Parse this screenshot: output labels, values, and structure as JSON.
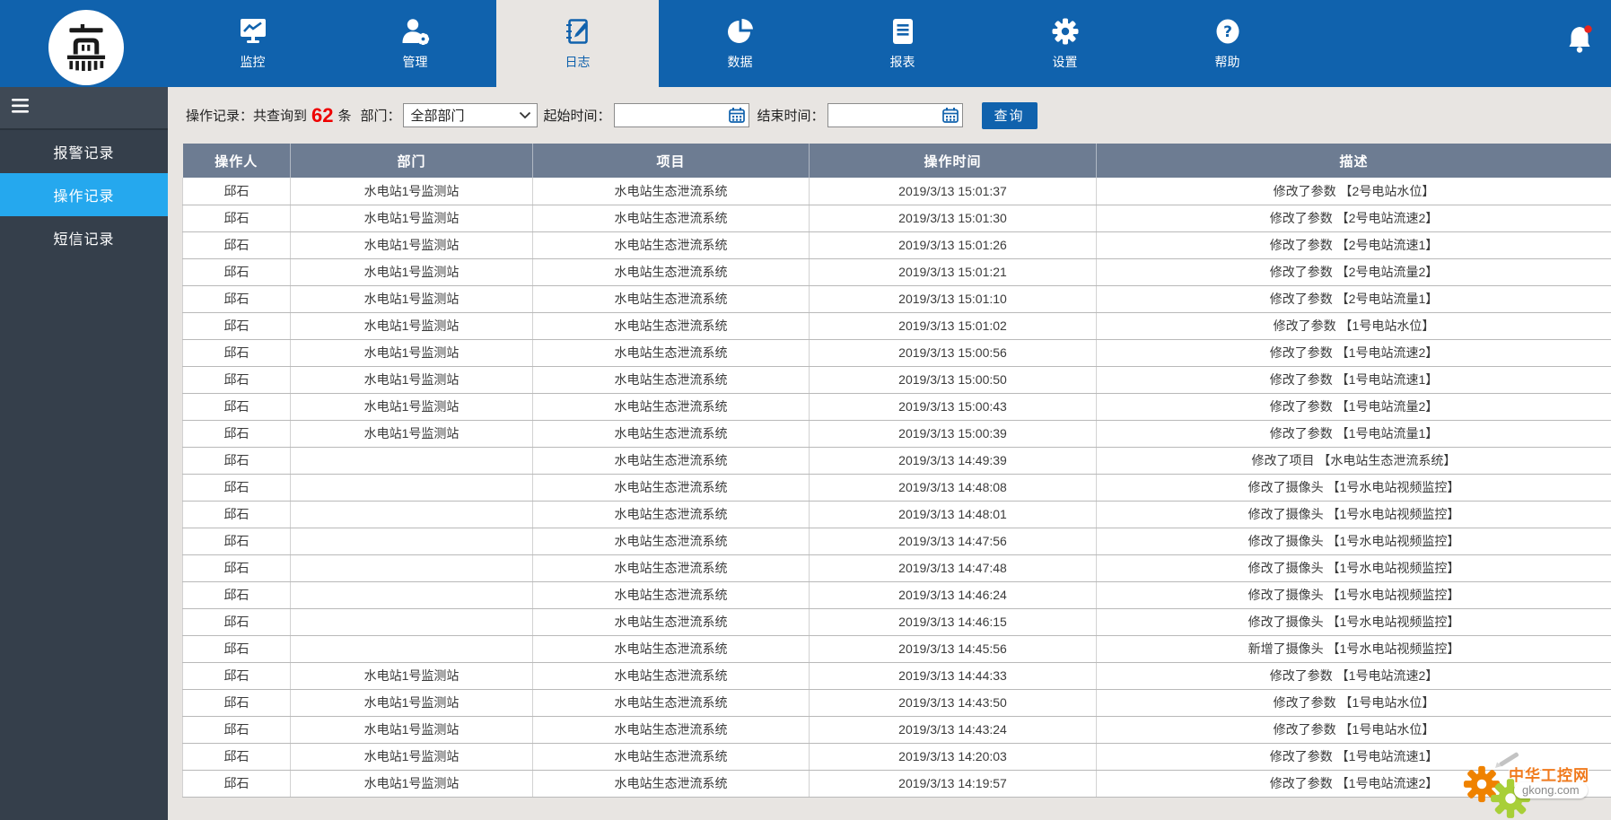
{
  "nav": {
    "items": [
      {
        "label": "监控",
        "icon": "monitor-chart-icon",
        "active": false
      },
      {
        "label": "管理",
        "icon": "user-gear-icon",
        "active": false
      },
      {
        "label": "日志",
        "icon": "log-notebook-icon",
        "active": true
      },
      {
        "label": "数据",
        "icon": "pie-chart-icon",
        "active": false
      },
      {
        "label": "报表",
        "icon": "report-document-icon",
        "active": false
      },
      {
        "label": "设置",
        "icon": "gear-icon",
        "active": false
      },
      {
        "label": "帮助",
        "icon": "help-icon",
        "active": false
      }
    ],
    "notification_icon": "bell-icon",
    "has_notification_dot": true
  },
  "sidebar": {
    "menu_icon": "hamburger-menu-icon",
    "items": [
      {
        "label": "报警记录",
        "active": false
      },
      {
        "label": "操作记录",
        "active": true
      },
      {
        "label": "短信记录",
        "active": false
      }
    ]
  },
  "filter": {
    "summary_prefix": "操作记录：共查询到",
    "summary_count": "62",
    "summary_suffix": "条",
    "department_label": "部门：",
    "department_value": "全部部门",
    "start_time_label": "起始时间：",
    "start_time_value": "",
    "end_time_label": "结束时间：",
    "end_time_value": "",
    "search_button": "查询"
  },
  "table": {
    "columns": [
      "操作人",
      "部门",
      "项目",
      "操作时间",
      "描述"
    ],
    "rows": [
      [
        "邱石",
        "水电站1号监测站",
        "水电站生态泄流系统",
        "2019/3/13 15:01:37",
        "修改了参数 【2号电站水位】"
      ],
      [
        "邱石",
        "水电站1号监测站",
        "水电站生态泄流系统",
        "2019/3/13 15:01:30",
        "修改了参数 【2号电站流速2】"
      ],
      [
        "邱石",
        "水电站1号监测站",
        "水电站生态泄流系统",
        "2019/3/13 15:01:26",
        "修改了参数 【2号电站流速1】"
      ],
      [
        "邱石",
        "水电站1号监测站",
        "水电站生态泄流系统",
        "2019/3/13 15:01:21",
        "修改了参数 【2号电站流量2】"
      ],
      [
        "邱石",
        "水电站1号监测站",
        "水电站生态泄流系统",
        "2019/3/13 15:01:10",
        "修改了参数 【2号电站流量1】"
      ],
      [
        "邱石",
        "水电站1号监测站",
        "水电站生态泄流系统",
        "2019/3/13 15:01:02",
        "修改了参数 【1号电站水位】"
      ],
      [
        "邱石",
        "水电站1号监测站",
        "水电站生态泄流系统",
        "2019/3/13 15:00:56",
        "修改了参数 【1号电站流速2】"
      ],
      [
        "邱石",
        "水电站1号监测站",
        "水电站生态泄流系统",
        "2019/3/13 15:00:50",
        "修改了参数 【1号电站流速1】"
      ],
      [
        "邱石",
        "水电站1号监测站",
        "水电站生态泄流系统",
        "2019/3/13 15:00:43",
        "修改了参数 【1号电站流量2】"
      ],
      [
        "邱石",
        "水电站1号监测站",
        "水电站生态泄流系统",
        "2019/3/13 15:00:39",
        "修改了参数 【1号电站流量1】"
      ],
      [
        "邱石",
        "",
        "水电站生态泄流系统",
        "2019/3/13 14:49:39",
        "修改了项目 【水电站生态泄流系统】"
      ],
      [
        "邱石",
        "",
        "水电站生态泄流系统",
        "2019/3/13 14:48:08",
        "修改了摄像头 【1号水电站视频监控】"
      ],
      [
        "邱石",
        "",
        "水电站生态泄流系统",
        "2019/3/13 14:48:01",
        "修改了摄像头 【1号水电站视频监控】"
      ],
      [
        "邱石",
        "",
        "水电站生态泄流系统",
        "2019/3/13 14:47:56",
        "修改了摄像头 【1号水电站视频监控】"
      ],
      [
        "邱石",
        "",
        "水电站生态泄流系统",
        "2019/3/13 14:47:48",
        "修改了摄像头 【1号水电站视频监控】"
      ],
      [
        "邱石",
        "",
        "水电站生态泄流系统",
        "2019/3/13 14:46:24",
        "修改了摄像头 【1号水电站视频监控】"
      ],
      [
        "邱石",
        "",
        "水电站生态泄流系统",
        "2019/3/13 14:46:15",
        "修改了摄像头 【1号水电站视频监控】"
      ],
      [
        "邱石",
        "",
        "水电站生态泄流系统",
        "2019/3/13 14:45:56",
        "新增了摄像头 【1号水电站视频监控】"
      ],
      [
        "邱石",
        "水电站1号监测站",
        "水电站生态泄流系统",
        "2019/3/13 14:44:33",
        "修改了参数 【1号电站流速2】"
      ],
      [
        "邱石",
        "水电站1号监测站",
        "水电站生态泄流系统",
        "2019/3/13 14:43:50",
        "修改了参数 【1号电站水位】"
      ],
      [
        "邱石",
        "水电站1号监测站",
        "水电站生态泄流系统",
        "2019/3/13 14:43:24",
        "修改了参数 【1号电站水位】"
      ],
      [
        "邱石",
        "水电站1号监测站",
        "水电站生态泄流系统",
        "2019/3/13 14:20:03",
        "修改了参数 【1号电站流速1】"
      ],
      [
        "邱石",
        "水电站1号监测站",
        "水电站生态泄流系统",
        "2019/3/13 14:19:57",
        "修改了参数 【1号电站流速2】"
      ]
    ]
  },
  "watermark": {
    "title": "中华工控网",
    "domain": "gkong.com"
  },
  "colors": {
    "nav_blue": "#1062ad",
    "active_tab_bg": "#e8e5e2",
    "sidebar_bg": "#353f4b",
    "sidebar_active": "#25a8ee",
    "table_header_bg": "#6d7c92",
    "count_red": "#ee0000",
    "notification_dot": "#e8251f",
    "watermark_orange": "#f07a1d",
    "watermark_green": "#a8cf38"
  }
}
